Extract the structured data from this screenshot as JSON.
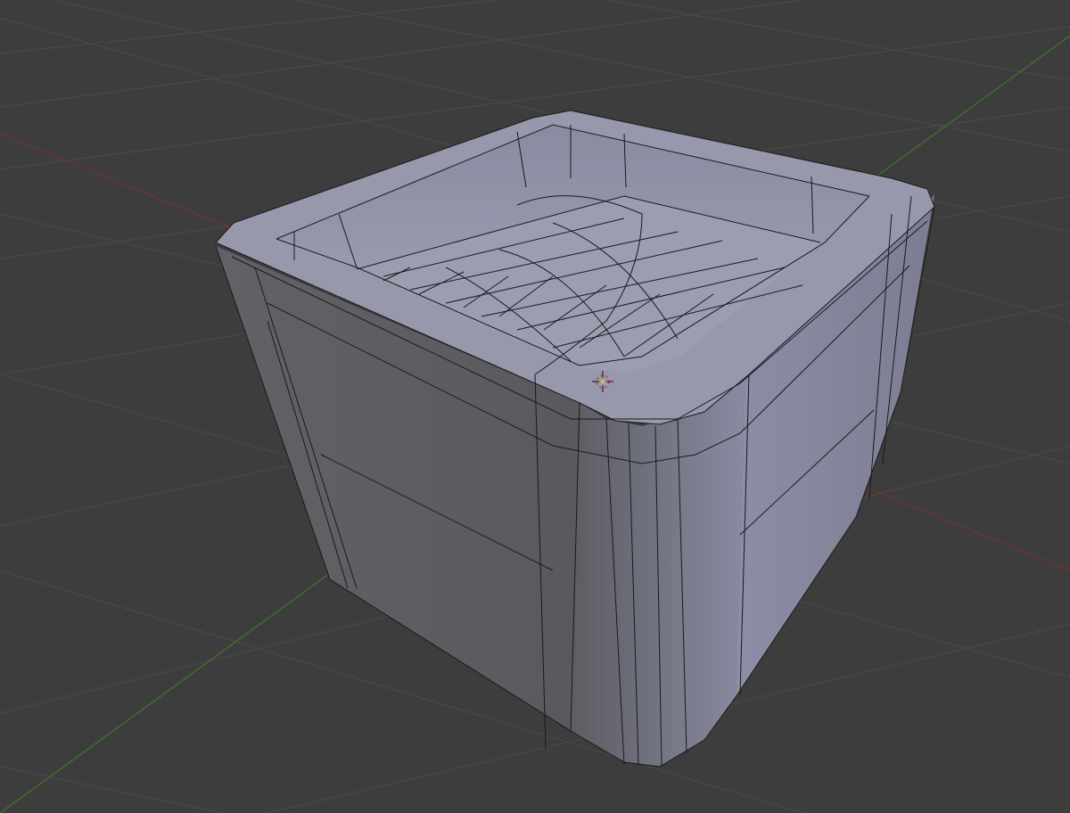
{
  "viewport": {
    "name": "3D Viewport",
    "mode": "wireframe-overlay",
    "background_color": "#3d3d3d",
    "grid_color": "#505050",
    "x_axis_color": "#8a3434",
    "y_axis_color": "#3f8a30"
  },
  "object": {
    "name": "rounded-box-tray",
    "side_light_color": "#8f90a8",
    "side_dark_color": "#5e5e64",
    "rim_color": "#9899ad",
    "floor_color": "#9a9bb0",
    "edge_color": "#1a1a1a"
  },
  "cursor_3d": {
    "visible": true,
    "icon": "crosshair-icon"
  }
}
